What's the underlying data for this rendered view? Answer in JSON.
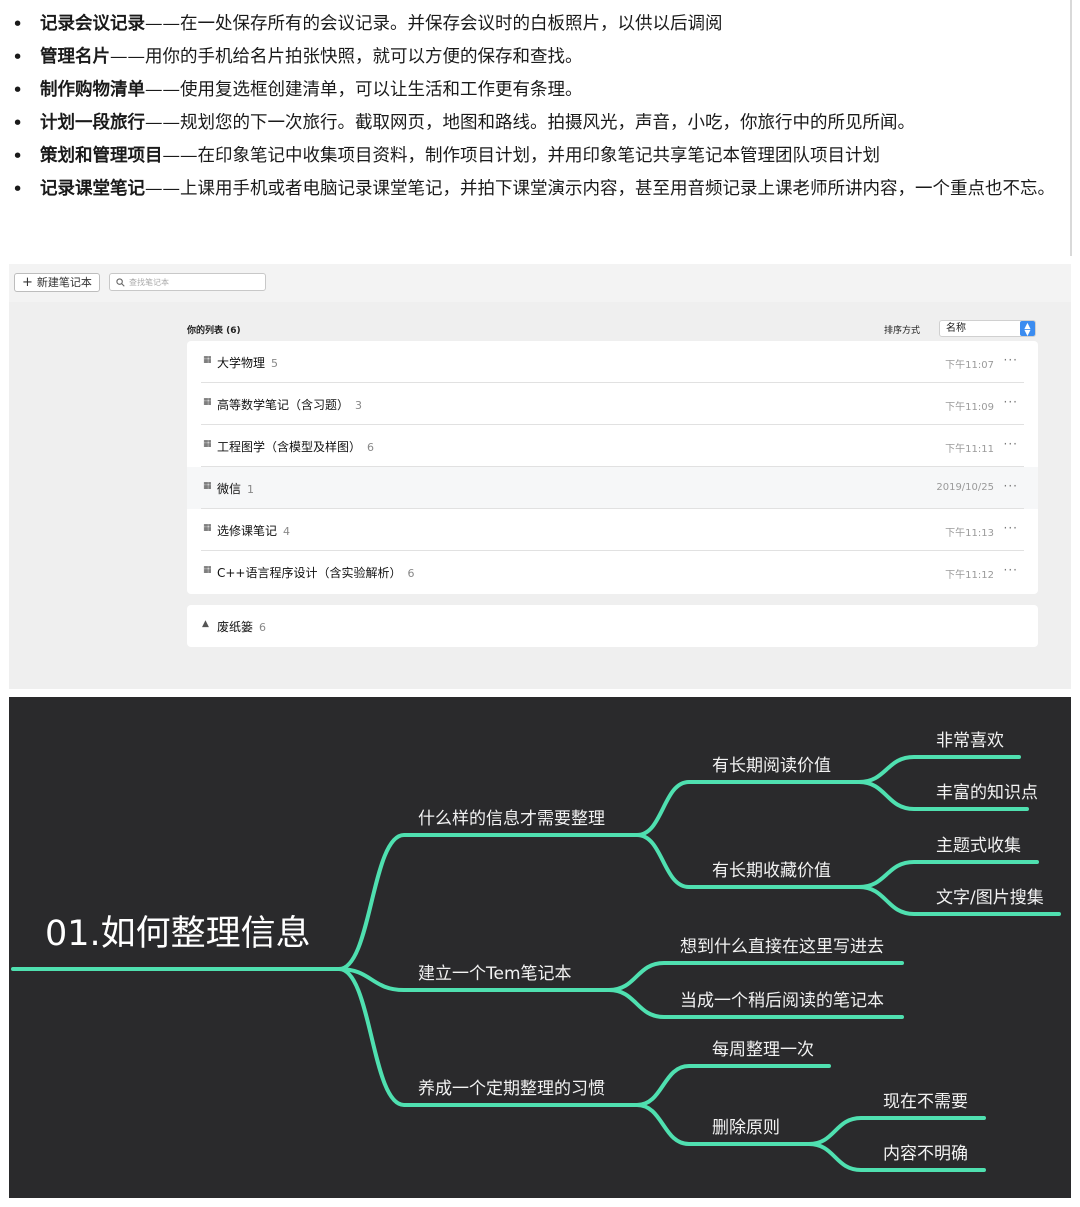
{
  "bullets": [
    {
      "title": "记录会议记录",
      "text": "——在一处保存所有的会议记录。并保存会议时的白板照片，以供以后调阅"
    },
    {
      "title": "管理名片",
      "text": "——用你的手机给名片拍张快照，就可以方便的保存和查找。"
    },
    {
      "title": "制作购物清单",
      "text": "——使用复选框创建清单，可以让生活和工作更有条理。"
    },
    {
      "title": "计划一段旅行",
      "text": "——规划您的下一次旅行。截取网页，地图和路线。拍摄风光，声音，小吃，你旅行中的所见所闻。"
    },
    {
      "title": "策划和管理项目",
      "text": "——在印象笔记中收集项目资料，制作项目计划，并用印象笔记共享笔记本管理团队项目计划"
    },
    {
      "title": "记录课堂笔记",
      "text": "——上课用手机或者电脑记录课堂笔记，并拍下课堂演示内容，甚至用音频记录上课老师所讲内容，一个重点也不忘。"
    }
  ],
  "app": {
    "new_notebook_label": "新建笔记本",
    "search_placeholder": "查找笔记本",
    "list_title": "你的列表 (6)",
    "sort_label": "排序方式",
    "sort_value": "名称",
    "notebooks": [
      {
        "name": "大学物理",
        "count": "5",
        "time": "下午11:07"
      },
      {
        "name": "高等数学笔记（含习题）",
        "count": "3",
        "time": "下午11:09"
      },
      {
        "name": "工程图学（含模型及样图）",
        "count": "6",
        "time": "下午11:11"
      },
      {
        "name": "微信",
        "count": "1",
        "time": "2019/10/25"
      },
      {
        "name": "选修课笔记",
        "count": "4",
        "time": "下午11:13"
      },
      {
        "name": "C++语言程序设计（含实验解析）",
        "count": "6",
        "time": "下午11:12"
      }
    ],
    "more_label": "···",
    "trash": {
      "name": "废纸篓",
      "count": "6"
    }
  },
  "mindmap": {
    "line_color": "#4fe0b0",
    "background": "#2a2a2c",
    "root": "01.如何整理信息",
    "branch1": {
      "label": "什么样的信息才需要整理",
      "a": {
        "label": "有长期阅读价值",
        "c1": "非常喜欢",
        "c2": "丰富的知识点"
      },
      "b": {
        "label": "有长期收藏价值",
        "c1": "主题式收集",
        "c2": "文字/图片搜集"
      }
    },
    "branch2": {
      "label": "建立一个Tem笔记本",
      "c1": "想到什么直接在这里写进去",
      "c2": "当成一个稍后阅读的笔记本"
    },
    "branch3": {
      "label": "养成一个定期整理的习惯",
      "c1": "每周整理一次",
      "b": {
        "label": "删除原则",
        "c1": "现在不需要",
        "c2": "内容不明确"
      }
    }
  }
}
